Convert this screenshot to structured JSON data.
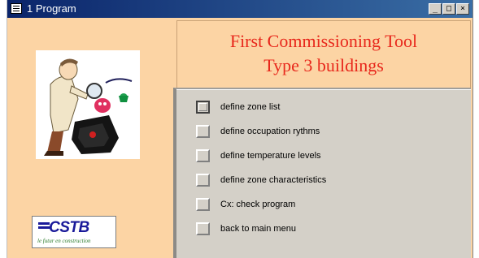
{
  "window": {
    "title": "1 Program",
    "controls": {
      "minimize": "_",
      "maximize": "□",
      "close": "×"
    }
  },
  "header": {
    "line1": "First Commissioning Tool",
    "line2": "Type 3 buildings"
  },
  "menu": {
    "items": [
      {
        "label": "define zone list",
        "active": true
      },
      {
        "label": "define occupation rythms"
      },
      {
        "label": "define temperature levels"
      },
      {
        "label": "define zone characteristics"
      },
      {
        "label": "Cx: check program"
      },
      {
        "label": "back to main menu"
      }
    ]
  },
  "logo": {
    "text": "CSTB",
    "slogan": "le futur en construction"
  },
  "colors": {
    "background": "#fcd4a4",
    "title_red": "#e8281c",
    "panel_gray": "#d4d0c8",
    "titlebar": "#0a246a"
  }
}
